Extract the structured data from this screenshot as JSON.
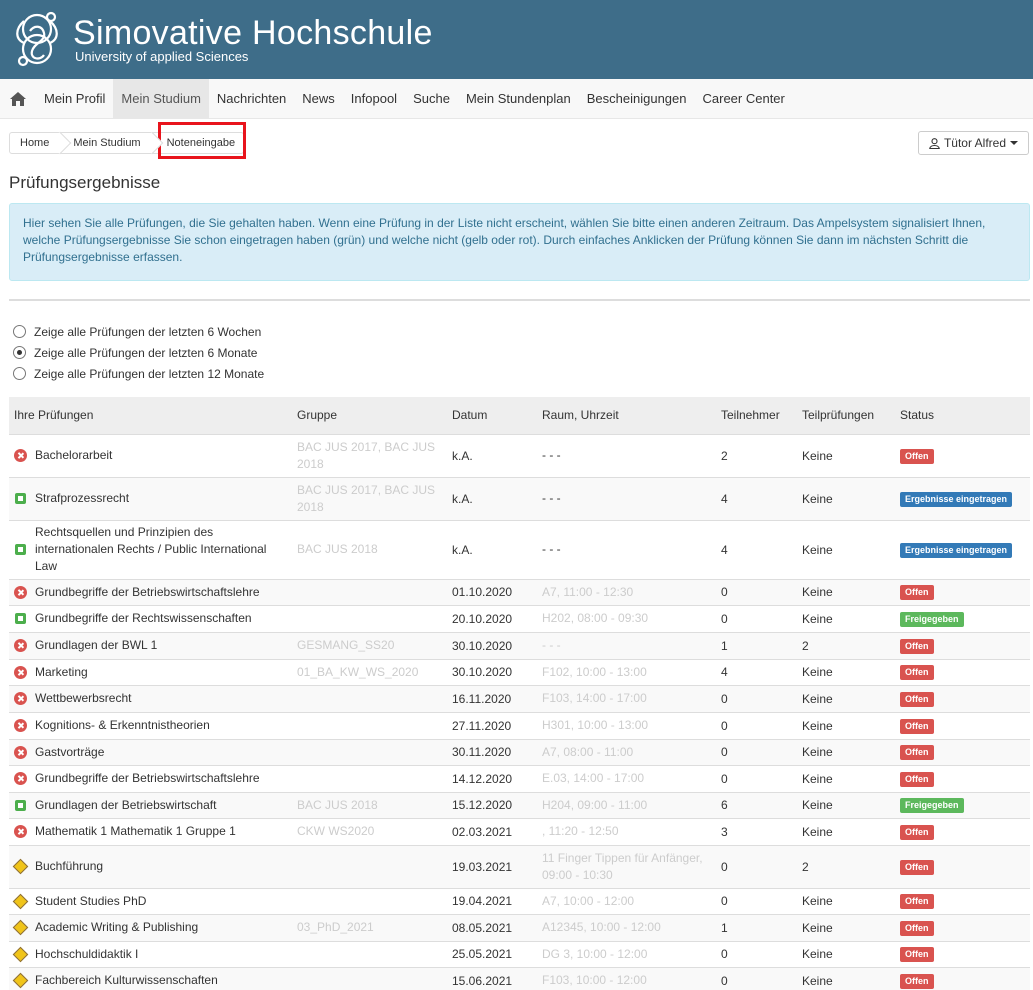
{
  "header": {
    "title": "Simovative  Hochschule",
    "subtitle": "University of applied Sciences",
    "bg_color": "#3e6d89"
  },
  "nav": {
    "home_icon": "home-icon",
    "items": [
      "Mein Profil",
      "Mein Studium",
      "Nachrichten",
      "News",
      "Infopool",
      "Suche",
      "Mein Stundenplan",
      "Bescheinigungen",
      "Career Center"
    ],
    "active": "Mein Studium"
  },
  "breadcrumb": {
    "home": "Home",
    "mid": "Mein Studium",
    "current": "Noteneingabe"
  },
  "user_button": {
    "icon": "user-icon",
    "label": "Tütor Alfred"
  },
  "page_title": "Prüfungsergebnisse",
  "info_text": "Hier sehen Sie alle Prüfungen, die Sie gehalten haben. Wenn eine Prüfung in der Liste nicht erscheint, wählen Sie bitte einen anderen Zeitraum. Das Ampelsystem signalisiert Ihnen, welche Prüfungsergebnisse Sie schon eingetragen haben (grün) und welche nicht (gelb oder rot). Durch einfaches Anklicken der Prüfung können Sie dann im nächsten Schritt die Prüfungsergebnisse erfassen.",
  "radios": [
    {
      "label": "Zeige alle Prüfungen der letzten 6 Wochen",
      "checked": false
    },
    {
      "label": "Zeige alle Prüfungen der letzten 6 Monate",
      "checked": true
    },
    {
      "label": "Zeige alle Prüfungen der letzten 12 Monate",
      "checked": false
    }
  ],
  "table": {
    "headers": [
      "Ihre Prüfungen",
      "Gruppe",
      "Datum",
      "Raum, Uhrzeit",
      "Teilnehmer",
      "Teilprüfungen",
      "Status"
    ],
    "rows": [
      {
        "icon": "red",
        "name": "Bachelorarbeit",
        "group": "BAC JUS 2017, BAC JUS 2018",
        "date": "k.A.",
        "room": "- - -",
        "room_faded": false,
        "participants": "2",
        "parts": "Keine",
        "status": "Offen",
        "status_type": "Offen"
      },
      {
        "icon": "green",
        "name": "Strafprozessrecht",
        "group": "BAC JUS 2017, BAC JUS 2018",
        "date": "k.A.",
        "room": "- - -",
        "room_faded": false,
        "participants": "4",
        "parts": "Keine",
        "status": "Ergebnisse eingetragen",
        "status_type": "blue"
      },
      {
        "icon": "green",
        "name": "Rechtsquellen und Prinzipien des internationalen Rechts / Public International Law",
        "group": "BAC JUS 2018",
        "date": "k.A.",
        "room": "- - -",
        "room_faded": false,
        "participants": "4",
        "parts": "Keine",
        "status": "Ergebnisse eingetragen",
        "status_type": "blue"
      },
      {
        "icon": "red",
        "name": "Grundbegriffe der Betriebswirtschaftslehre",
        "group": "",
        "date": "01.10.2020",
        "room": "A7, 11:00 - 12:30",
        "room_faded": true,
        "participants": "0",
        "parts": "Keine",
        "status": "Offen",
        "status_type": "Offen"
      },
      {
        "icon": "green",
        "name": "Grundbegriffe der Rechtswissenschaften",
        "group": "",
        "date": "20.10.2020",
        "room": "H202, 08:00 - 09:30",
        "room_faded": true,
        "participants": "0",
        "parts": "Keine",
        "status": "Freigegeben",
        "status_type": "green"
      },
      {
        "icon": "red",
        "name": "Grundlagen der BWL 1",
        "group": "GESMANG_SS20",
        "date": "30.10.2020",
        "room": "- - -",
        "room_faded": true,
        "participants": "1",
        "parts": "2",
        "status": "Offen",
        "status_type": "Offen"
      },
      {
        "icon": "red",
        "name": "Marketing",
        "group": "01_BA_KW_WS_2020",
        "date": "30.10.2020",
        "room": "F102, 10:00 - 13:00",
        "room_faded": true,
        "participants": "4",
        "parts": "Keine",
        "status": "Offen",
        "status_type": "Offen"
      },
      {
        "icon": "red",
        "name": "Wettbewerbsrecht",
        "group": "",
        "date": "16.11.2020",
        "room": "F103, 14:00 - 17:00",
        "room_faded": true,
        "participants": "0",
        "parts": "Keine",
        "status": "Offen",
        "status_type": "Offen"
      },
      {
        "icon": "red",
        "name": "Kognitions- & Erkenntnistheorien",
        "group": "",
        "date": "27.11.2020",
        "room": "H301, 10:00 - 13:00",
        "room_faded": true,
        "participants": "0",
        "parts": "Keine",
        "status": "Offen",
        "status_type": "Offen"
      },
      {
        "icon": "red",
        "name": "Gastvorträge",
        "group": "",
        "date": "30.11.2020",
        "room": "A7, 08:00 - 11:00",
        "room_faded": true,
        "participants": "0",
        "parts": "Keine",
        "status": "Offen",
        "status_type": "Offen"
      },
      {
        "icon": "red",
        "name": "Grundbegriffe der Betriebswirtschaftslehre",
        "group": "",
        "date": "14.12.2020",
        "room": "E.03, 14:00 - 17:00",
        "room_faded": true,
        "participants": "0",
        "parts": "Keine",
        "status": "Offen",
        "status_type": "Offen"
      },
      {
        "icon": "green",
        "name": "Grundlagen der Betriebswirtschaft",
        "group": "BAC JUS 2018",
        "date": "15.12.2020",
        "room": "H204, 09:00 - 11:00",
        "room_faded": true,
        "participants": "6",
        "parts": "Keine",
        "status": "Freigegeben",
        "status_type": "green"
      },
      {
        "icon": "red",
        "name": "Mathematik 1 Mathematik 1 Gruppe 1",
        "group": "CKW WS2020",
        "date": "02.03.2021",
        "room": ", 11:20 - 12:50",
        "room_faded": true,
        "participants": "3",
        "parts": "Keine",
        "status": "Offen",
        "status_type": "Offen"
      },
      {
        "icon": "yellow",
        "name": "Buchführung",
        "group": "",
        "date": "19.03.2021",
        "room": "11 Finger Tippen für Anfänger, 09:00 - 10:30",
        "room_faded": true,
        "participants": "0",
        "parts": "2",
        "status": "Offen",
        "status_type": "Offen"
      },
      {
        "icon": "yellow",
        "name": "Student Studies PhD",
        "group": "",
        "date": "19.04.2021",
        "room": "A7, 10:00 - 12:00",
        "room_faded": true,
        "participants": "0",
        "parts": "Keine",
        "status": "Offen",
        "status_type": "Offen"
      },
      {
        "icon": "yellow",
        "name": "Academic Writing & Publishing",
        "group": "03_PhD_2021",
        "date": "08.05.2021",
        "room": "A12345, 10:00 - 12:00",
        "room_faded": true,
        "participants": "1",
        "parts": "Keine",
        "status": "Offen",
        "status_type": "Offen"
      },
      {
        "icon": "yellow",
        "name": "Hochschuldidaktik I",
        "group": "",
        "date": "25.05.2021",
        "room": "DG 3, 10:00 - 12:00",
        "room_faded": true,
        "participants": "0",
        "parts": "Keine",
        "status": "Offen",
        "status_type": "Offen"
      },
      {
        "icon": "yellow",
        "name": "Fachbereich Kulturwissenschaften",
        "group": "",
        "date": "15.06.2021",
        "room": "F103, 10:00 - 12:00",
        "room_faded": true,
        "participants": "0",
        "parts": "Keine",
        "status": "Offen",
        "status_type": "Offen"
      }
    ]
  }
}
